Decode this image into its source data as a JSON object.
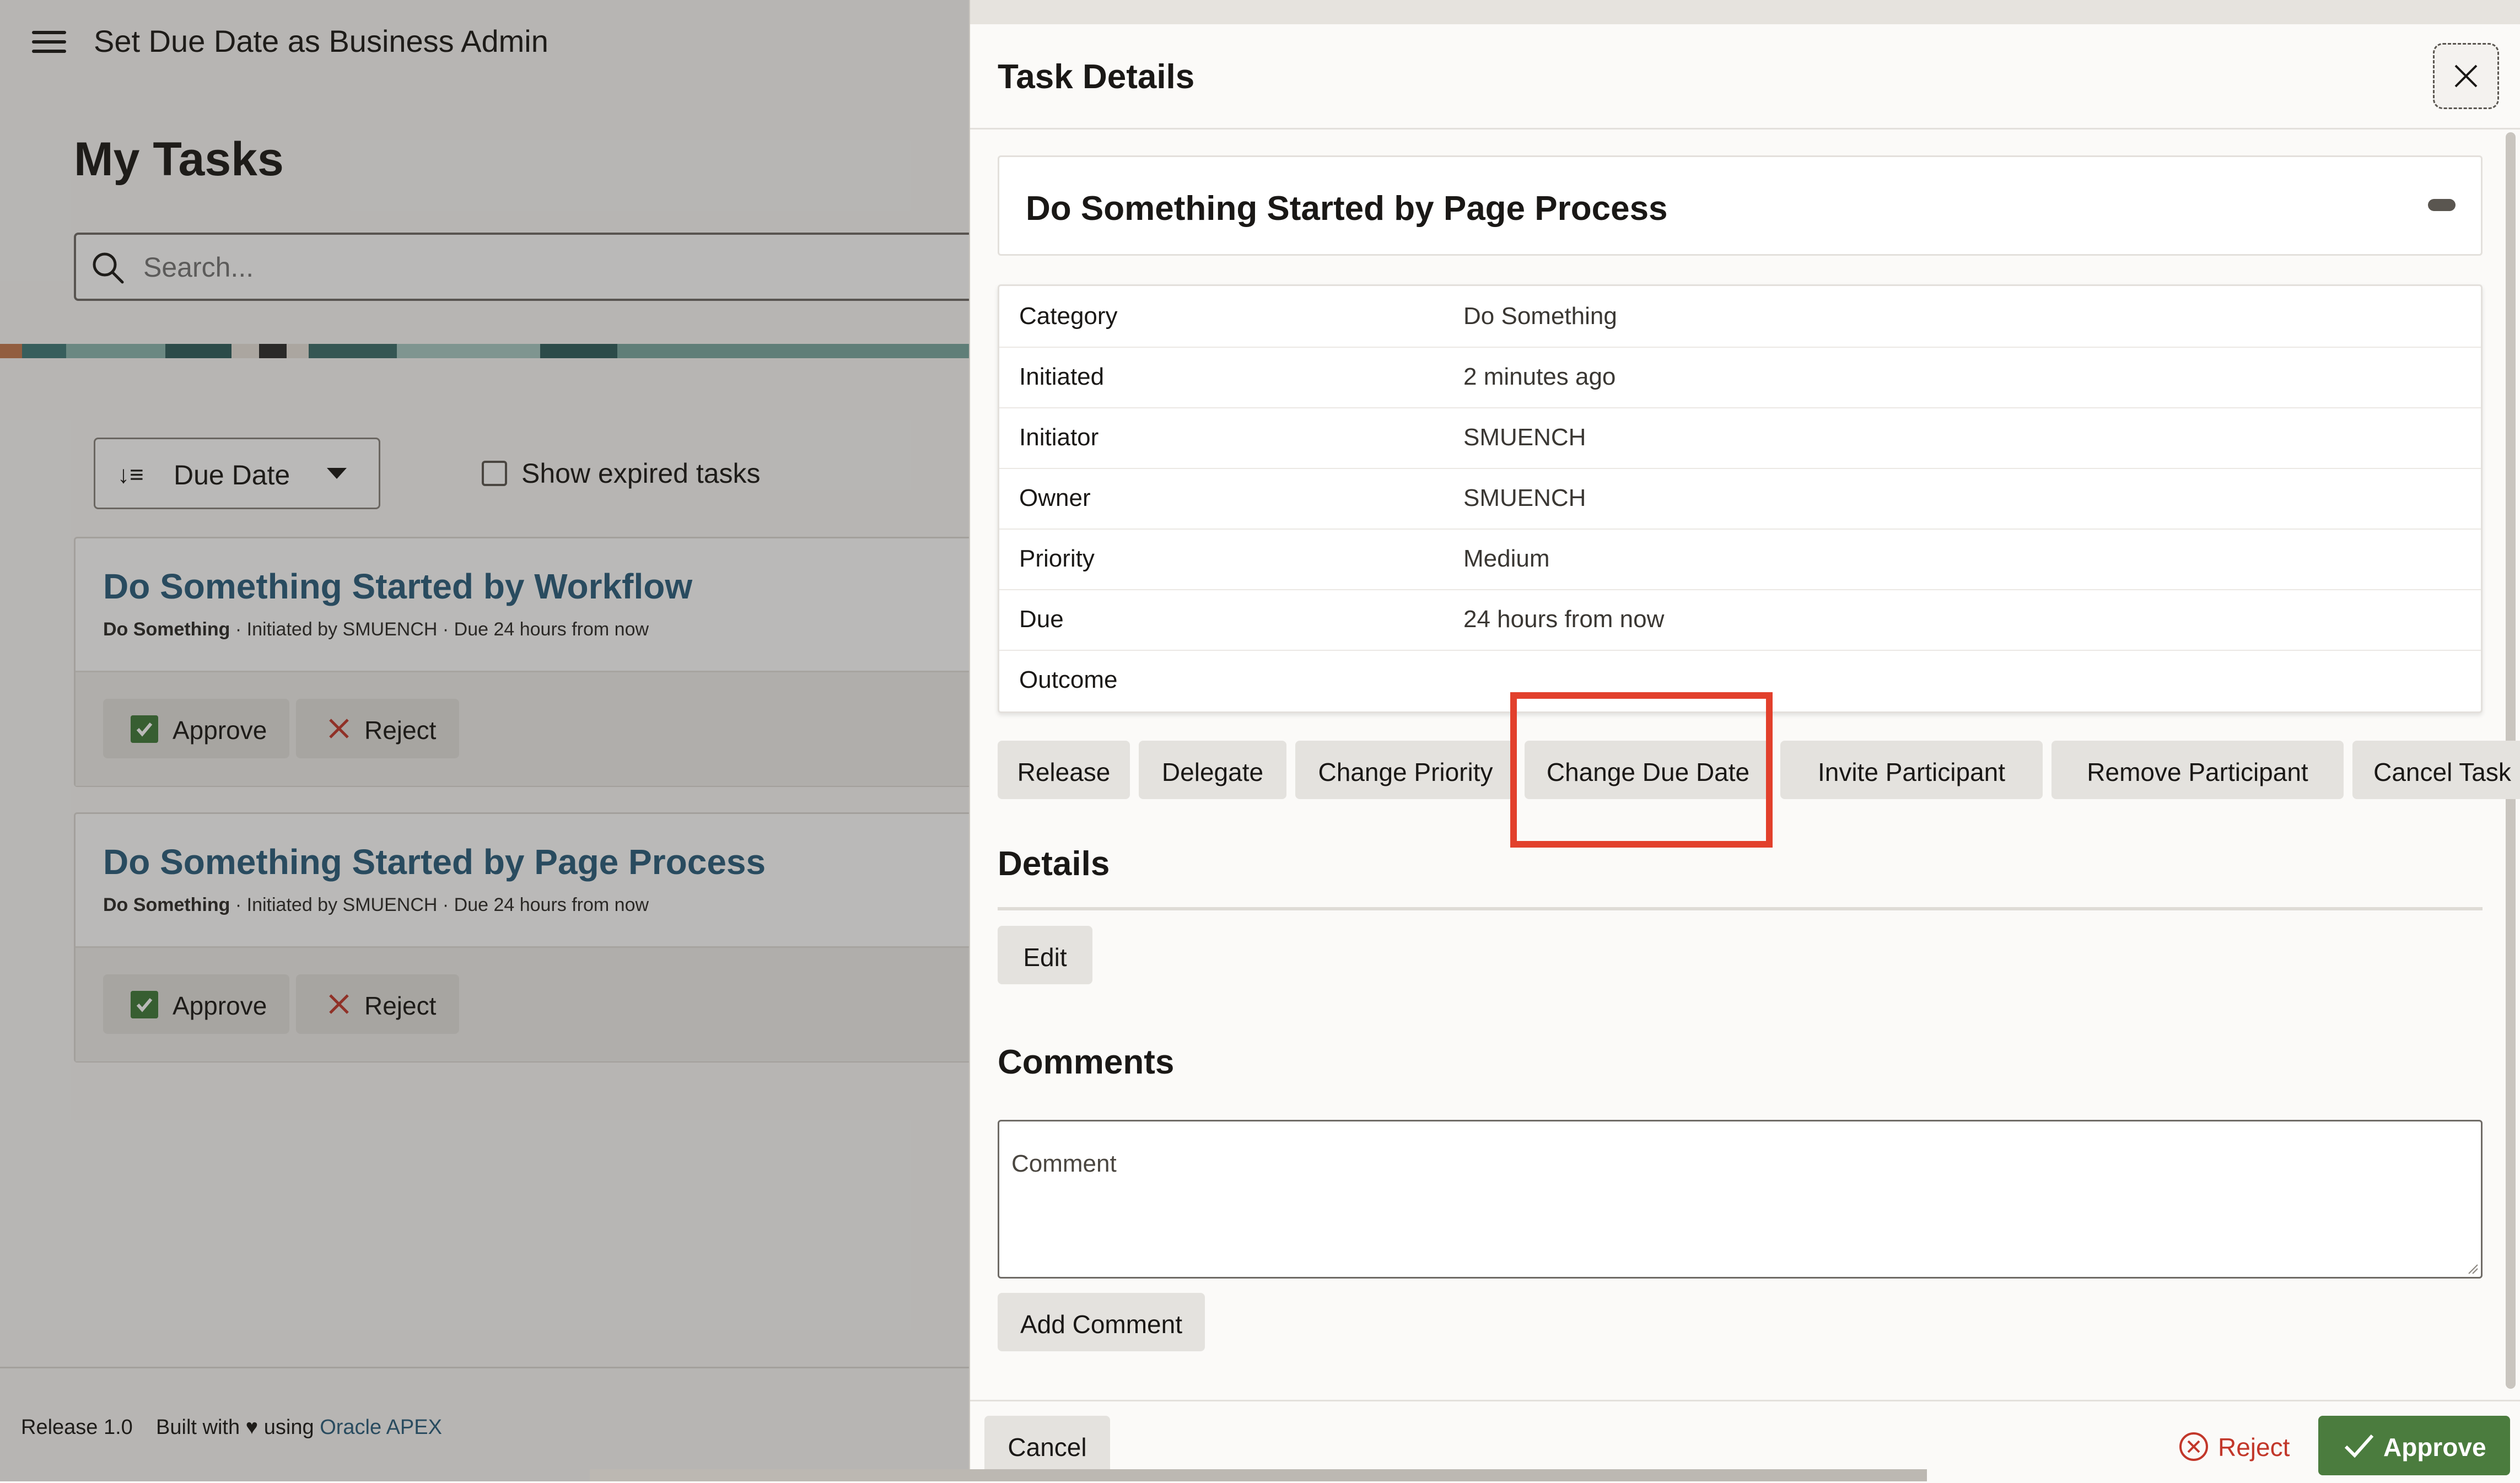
{
  "app": {
    "title": "Set Due Date as Business Admin"
  },
  "page": {
    "heading": "My Tasks",
    "search_placeholder": "Search...",
    "sort": {
      "selected": "Due Date"
    },
    "show_expired_label": "Show expired tasks",
    "tasks": [
      {
        "title": "Do Something Started by Workflow",
        "category": "Do Something",
        "meta": " · Initiated by SMUENCH · Due 24 hours from now",
        "approve_label": "Approve",
        "reject_label": "Reject"
      },
      {
        "title": "Do Something Started by Page Process",
        "category": "Do Something",
        "meta": " · Initiated by SMUENCH · Due 24 hours from now",
        "approve_label": "Approve",
        "reject_label": "Reject"
      }
    ],
    "footer": {
      "release": "Release 1.0",
      "built_with": "Built with",
      "using": "using",
      "link": "Oracle APEX"
    }
  },
  "dialog": {
    "title": "Task Details",
    "task_title": "Do Something Started by Page Process",
    "properties": [
      {
        "label": "Category",
        "value": "Do Something"
      },
      {
        "label": "Initiated",
        "value": "2 minutes ago"
      },
      {
        "label": "Initiator",
        "value": "SMUENCH"
      },
      {
        "label": "Owner",
        "value": "SMUENCH"
      },
      {
        "label": "Priority",
        "value": "Medium"
      },
      {
        "label": "Due",
        "value": "24 hours from now"
      },
      {
        "label": "Outcome",
        "value": ""
      }
    ],
    "actions": [
      "Release",
      "Delegate",
      "Change Priority",
      "Change Due Date",
      "Invite Participant",
      "Remove Participant",
      "Cancel Task"
    ],
    "details_heading": "Details",
    "edit_label": "Edit",
    "comments_heading": "Comments",
    "comment_placeholder": "Comment",
    "add_comment_label": "Add Comment",
    "footer": {
      "cancel": "Cancel",
      "reject": "Reject",
      "approve": "Approve"
    }
  },
  "colors": {
    "accent_link": "#2a5d7c",
    "approve_green": "#4b7c3e",
    "reject_red": "#c2372a",
    "highlight": "#e2402c"
  }
}
